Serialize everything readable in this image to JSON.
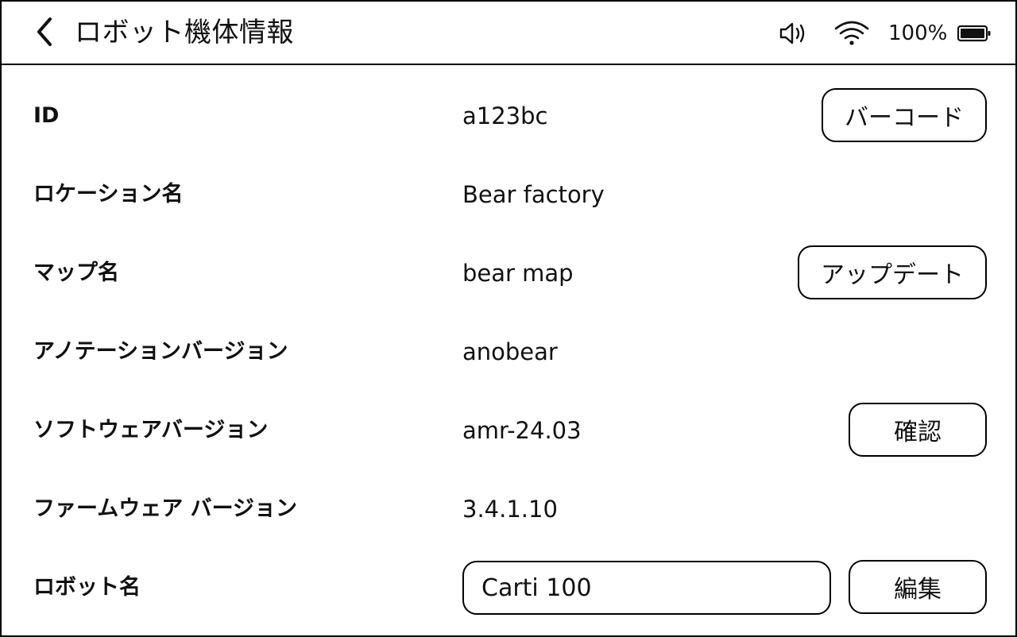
{
  "header": {
    "title": "ロボット機体情報",
    "back_icon": "chevron-left-icon",
    "volume_icon": "speaker-icon",
    "wifi_icon": "wifi-icon",
    "battery_percent": "100%",
    "battery_icon": "battery-icon",
    "battery_level": 1.0
  },
  "rows": {
    "id": {
      "label": "ID",
      "value": "a123bc",
      "button": "バーコード"
    },
    "location": {
      "label": "ロケーション名",
      "value": "Bear factory"
    },
    "map": {
      "label": "マップ名",
      "value": "bear map",
      "button": "アップデート"
    },
    "annotation": {
      "label": "アノテーションバージョン",
      "value": "anobear"
    },
    "software": {
      "label": "ソフトウェアバージョン",
      "value": "amr-24.03",
      "button": "確認"
    },
    "firmware": {
      "label": "ファームウェア バージョン",
      "value": "3.4.1.10"
    },
    "robot_name": {
      "label": "ロボット名",
      "input_value": "Carti 100",
      "button": "編集"
    }
  }
}
